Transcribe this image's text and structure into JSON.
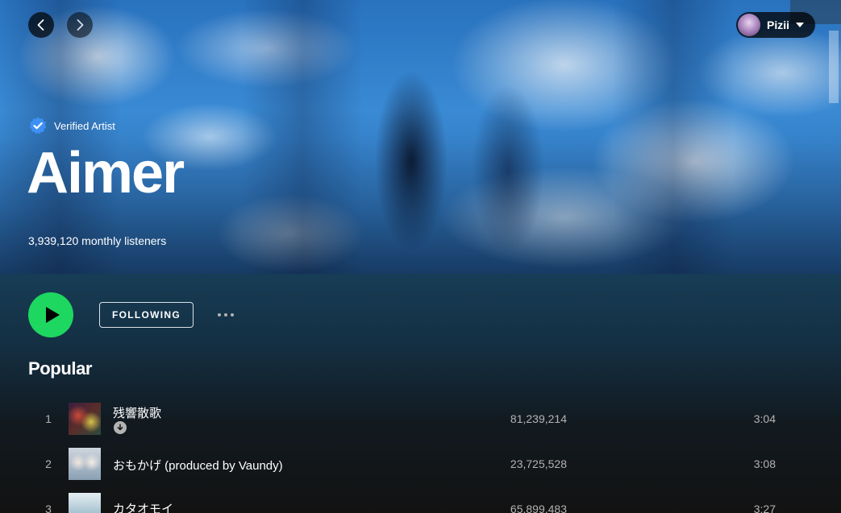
{
  "nav": {
    "back_icon": "chevron-left-icon",
    "forward_icon": "chevron-right-icon"
  },
  "user": {
    "name": "Pizii",
    "avatar_icon": "avatar",
    "menu_icon": "caret-down-icon"
  },
  "artist": {
    "verified_label": "Verified Artist",
    "name": "Aimer",
    "monthly_listeners": "3,939,120 monthly listeners"
  },
  "actions": {
    "follow_label": "FOLLOWING",
    "play_icon": "play-icon",
    "more_icon": "more-options-icon"
  },
  "popular": {
    "title": "Popular",
    "tracks": [
      {
        "index": "1",
        "title": "残響散歌",
        "plays": "81,239,214",
        "duration": "3:04",
        "downloaded": true
      },
      {
        "index": "2",
        "title": "おもかげ (produced by Vaundy)",
        "plays": "23,725,528",
        "duration": "3:08",
        "downloaded": false
      },
      {
        "index": "3",
        "title": "カタオモイ",
        "plays": "65,899,483",
        "duration": "3:27",
        "downloaded": false
      }
    ]
  },
  "colors": {
    "accent": "#1ed760",
    "verified_badge": "#3d91f4",
    "background": "#121212"
  }
}
